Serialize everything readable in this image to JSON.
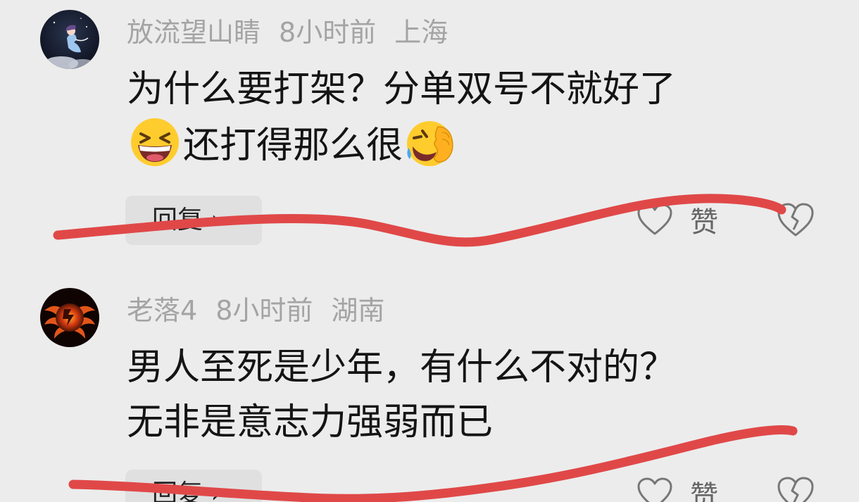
{
  "comments": [
    {
      "username": "放流望山睛",
      "time": "8小时前",
      "location": "上海",
      "line1": "为什么要打架？分单双号不就好了",
      "line2_emoji_left": "grinning-squinting-face",
      "line2_text": "还打得那么很",
      "line2_emoji_right": "rolling-on-floor-laughing-face",
      "reply_label": "回复 ›",
      "like_label": "赞"
    },
    {
      "username": "老落4",
      "time": "8小时前",
      "location": "湖南",
      "line1": "男人至死是少年，有什么不对的？",
      "line2_text": "无非是意志力强弱而已",
      "reply_label": "回复 ›",
      "like_label": "赞"
    }
  ],
  "colors": {
    "background": "#ececec",
    "meta_text": "#a4a4a4",
    "body_text": "#141414",
    "reply_bg": "#e0e0e0",
    "scribble_red": "#e04848"
  },
  "icons": [
    "avatar-mermaid",
    "avatar-fire-wings",
    "heart-outline-icon",
    "broken-heart-icon",
    "chevron-right-icon"
  ]
}
